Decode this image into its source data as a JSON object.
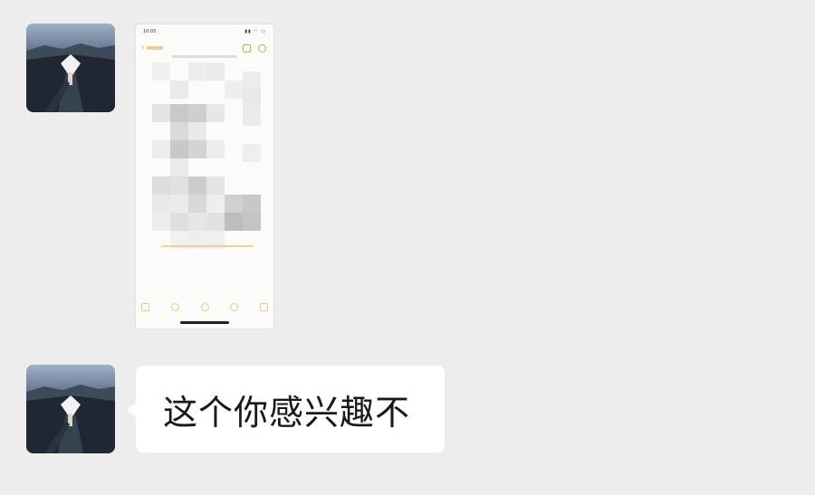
{
  "messages": [
    {
      "type": "image",
      "sender_avatar": "avatar-landscape",
      "phone_screenshot": {
        "status_time": "10:05",
        "status_icons": "signal-wifi-battery",
        "accent_color": "#d9a441"
      }
    },
    {
      "type": "text",
      "sender_avatar": "avatar-landscape",
      "text": "这个你感兴趣不"
    }
  ],
  "colors": {
    "background": "#ededed",
    "bubble": "#ffffff",
    "text": "#191919"
  }
}
